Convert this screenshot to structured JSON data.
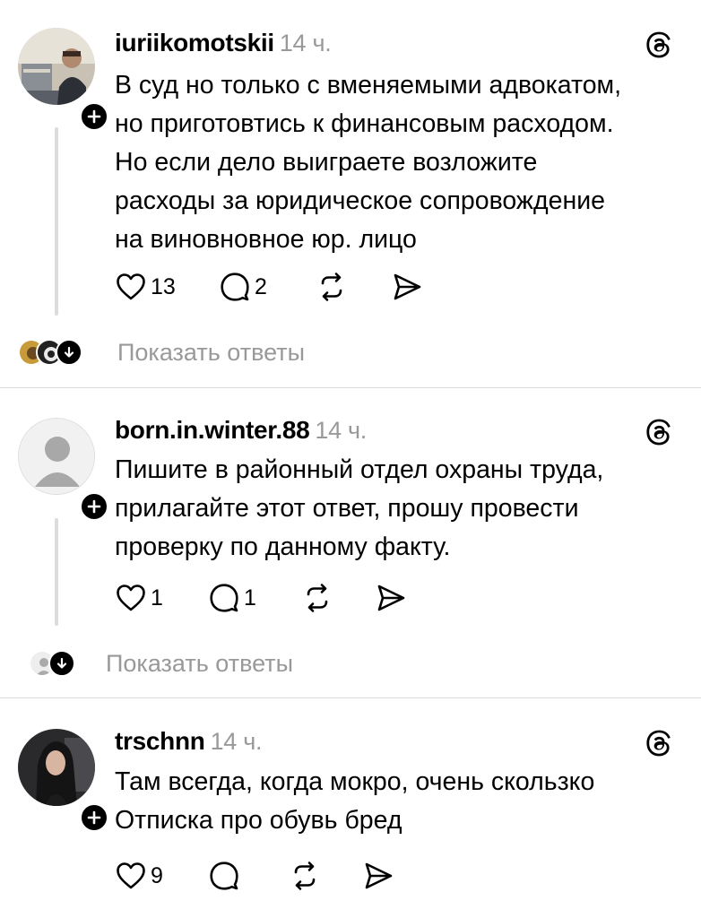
{
  "posts": [
    {
      "username": "iuriikomotskii",
      "time": "14 ч.",
      "lines": [
        "В суд но только с вменяемыми адвокатом,",
        "но приготовтись к финансовым расходом.",
        "Но если дело выиграете возложите",
        "расходы за юридическое сопровождение",
        "на виновновное юр. лицо"
      ],
      "likes": "13",
      "replies": "2",
      "show_replies": "Показать ответы"
    },
    {
      "username": "born.in.winter.88",
      "time": "14 ч.",
      "lines": [
        "Пишите в районный отдел охраны труда,",
        "прилагайте этот ответ, прошу провести",
        "проверку по данному факту."
      ],
      "likes": "1",
      "replies": "1",
      "show_replies": "Показать ответы"
    },
    {
      "username": "trschnn",
      "time": "14 ч.",
      "lines": [
        "Там всегда, когда мокро, очень скользко",
        "Отписка про обувь бред"
      ],
      "likes": "9",
      "replies": ""
    }
  ],
  "icons": {
    "like": "heart-icon",
    "reply": "comment-bubble-icon",
    "repost": "repost-icon",
    "share": "send-icon",
    "app": "threads-logo-icon",
    "follow": "plus-icon",
    "expand": "arrow-down-icon"
  },
  "colors": {
    "text": "#000000",
    "muted": "#999999",
    "divider": "#dbdbdb",
    "thread_line": "#dcdcdc"
  }
}
